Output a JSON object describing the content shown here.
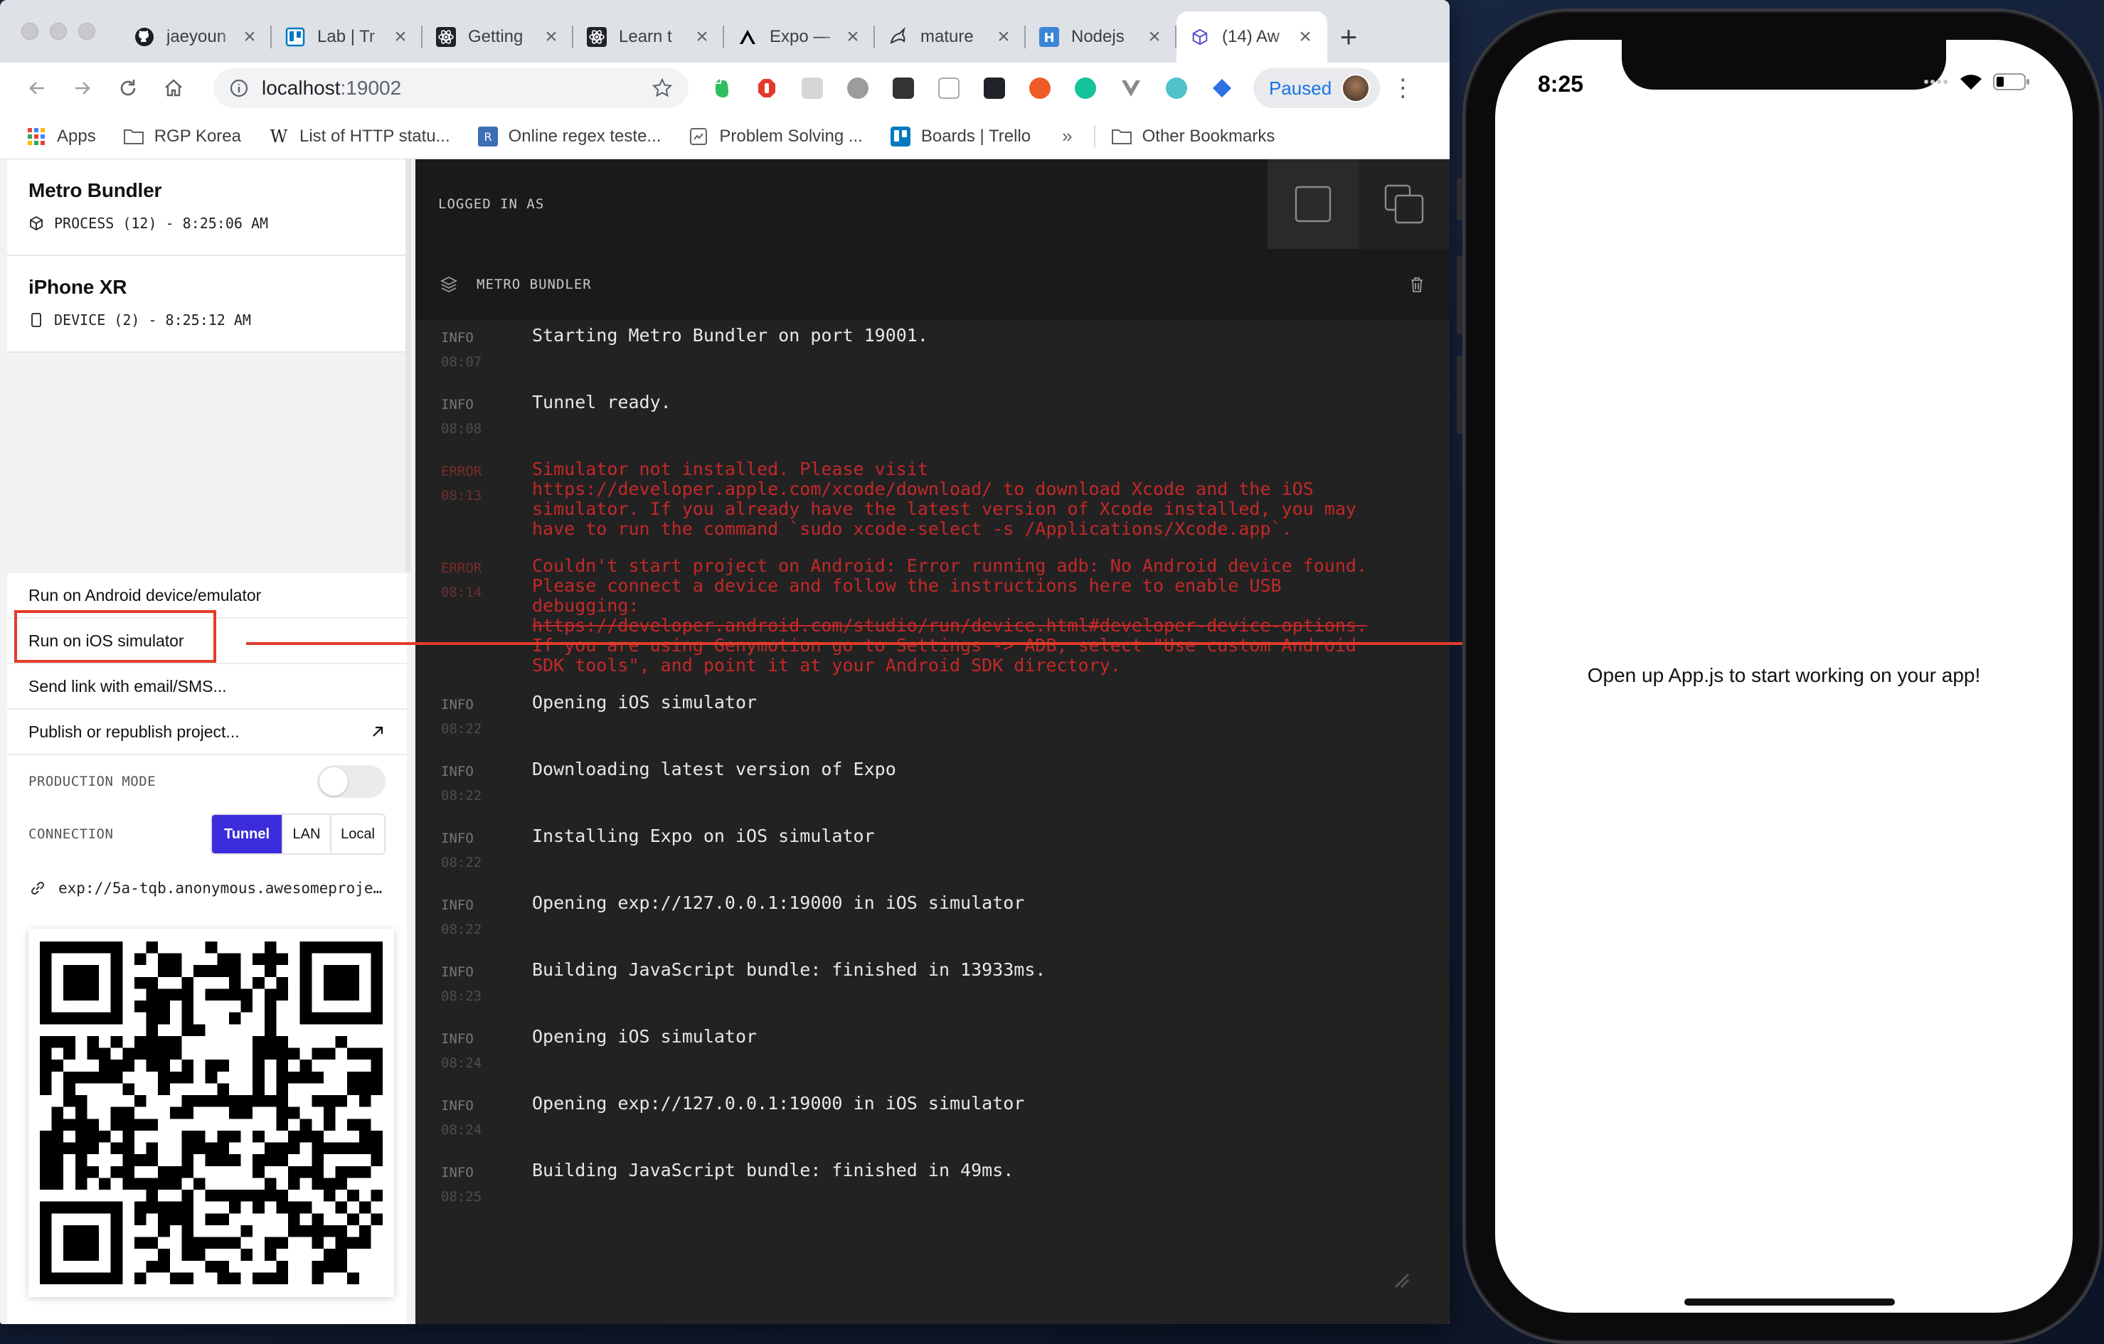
{
  "browser": {
    "tabs": [
      {
        "title": "jaeyoun",
        "icon": "github-icon",
        "active": false
      },
      {
        "title": "Lab | Tr",
        "icon": "trello-icon",
        "active": false
      },
      {
        "title": "Getting",
        "icon": "react-icon",
        "active": false
      },
      {
        "title": "Learn t",
        "icon": "react-icon",
        "active": false
      },
      {
        "title": "Expo —",
        "icon": "expo-icon",
        "active": false
      },
      {
        "title": "mature",
        "icon": "unicorn-icon",
        "active": false
      },
      {
        "title": "Nodejs",
        "icon": "h-icon",
        "active": false
      },
      {
        "title": "(14) Aw",
        "icon": "expo-cube-icon",
        "active": true
      }
    ],
    "url_host": "localhost",
    "url_port": ":19002",
    "profile_status": "Paused",
    "bookmarks": [
      {
        "label": "Apps",
        "icon": "apps-grid-icon"
      },
      {
        "label": "RGP Korea",
        "icon": "folder-icon"
      },
      {
        "label": "List of HTTP statu...",
        "icon": "wikipedia-icon"
      },
      {
        "label": "Online regex teste...",
        "icon": "regex-icon"
      },
      {
        "label": "Problem Solving ...",
        "icon": "page-icon"
      },
      {
        "label": "Boards | Trello",
        "icon": "trello-icon"
      }
    ],
    "bookmarks_overflow": "»",
    "other_bookmarks": "Other Bookmarks"
  },
  "sidebar": {
    "sources": [
      {
        "name": "Metro Bundler",
        "meta": "PROCESS (12) - 8:25:06 AM",
        "icon": "cube-icon"
      },
      {
        "name": "iPhone XR",
        "meta": "DEVICE (2) - 8:25:12 AM",
        "icon": "phone-icon"
      }
    ],
    "actions": [
      {
        "label": "Run on Android device/emulator"
      },
      {
        "label": "Run on iOS simulator"
      },
      {
        "label": "Send link with email/SMS..."
      },
      {
        "label": "Publish or republish project..."
      }
    ],
    "production_mode_label": "PRODUCTION MODE",
    "production_mode_on": false,
    "connection_label": "CONNECTION",
    "connection_options": [
      "Tunnel",
      "LAN",
      "Local"
    ],
    "connection_selected": "Tunnel",
    "project_url": "exp://5a-tqb.anonymous.awesomeproje…"
  },
  "logs": {
    "logged_in_label": "LOGGED IN AS",
    "panel_title": "METRO BUNDLER",
    "entries": [
      {
        "level": "INFO",
        "time": "08:07",
        "message": "Starting Metro Bundler on port 19001."
      },
      {
        "level": "INFO",
        "time": "08:08",
        "message": "Tunnel ready."
      },
      {
        "level": "ERROR",
        "time": "08:13",
        "message": "Simulator not installed. Please visit\nhttps://developer.apple.com/xcode/download/ to download Xcode and the iOS\nsimulator. If you already have the latest version of Xcode installed, you may\nhave to run the command `sudo xcode-select -s /Applications/Xcode.app`."
      },
      {
        "level": "ERROR",
        "time": "08:14",
        "message": "Couldn't start project on Android: Error running adb: No Android device found.\nPlease connect a device and follow the instructions here to enable USB\ndebugging:\nhttps://developer.android.com/studio/run/device.html#developer-device-options.\nIf you are using Genymotion go to Settings -> ADB, select \"Use custom Android\nSDK tools\", and point it at your Android SDK directory."
      },
      {
        "level": "INFO",
        "time": "08:22",
        "message": "Opening iOS simulator"
      },
      {
        "level": "INFO",
        "time": "08:22",
        "message": "Downloading latest version of Expo"
      },
      {
        "level": "INFO",
        "time": "08:22",
        "message": "Installing Expo on iOS simulator"
      },
      {
        "level": "INFO",
        "time": "08:22",
        "message": "Opening exp://127.0.0.1:19000 in iOS simulator"
      },
      {
        "level": "INFO",
        "time": "08:23",
        "message": "Building JavaScript bundle: finished in 13933ms."
      },
      {
        "level": "INFO",
        "time": "08:24",
        "message": "Opening iOS simulator"
      },
      {
        "level": "INFO",
        "time": "08:24",
        "message": "Opening exp://127.0.0.1:19000 in iOS simulator"
      },
      {
        "level": "INFO",
        "time": "08:25",
        "message": "Building JavaScript bundle: finished in 49ms."
      }
    ]
  },
  "simulator": {
    "time": "8:25",
    "app_text": "Open up App.js to start working on your app!"
  },
  "colors": {
    "accent": "#3b2cdb",
    "annotation": "#e23c2c",
    "error_text": "#c42828",
    "log_bg": "#222222"
  }
}
